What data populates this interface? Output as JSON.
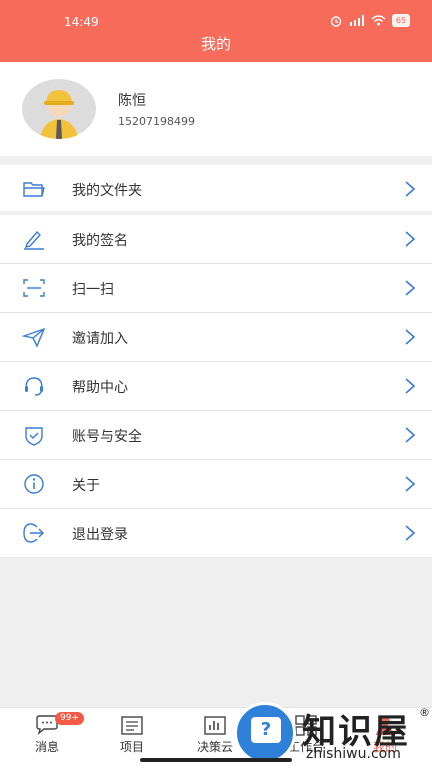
{
  "status_bar": {
    "time": "14:49",
    "battery": "65"
  },
  "header": {
    "title": "我的"
  },
  "profile": {
    "name": "陈恒",
    "phone": "15207198499"
  },
  "menu": [
    {
      "label": "我的文件夹",
      "icon": "folder-icon"
    },
    {
      "label": "我的签名",
      "icon": "pen-icon"
    },
    {
      "label": "扫一扫",
      "icon": "scan-icon"
    },
    {
      "label": "邀请加入",
      "icon": "send-icon"
    },
    {
      "label": "帮助中心",
      "icon": "headset-icon"
    },
    {
      "label": "账号与安全",
      "icon": "shield-icon"
    },
    {
      "label": "关于",
      "icon": "info-icon"
    },
    {
      "label": "退出登录",
      "icon": "logout-icon"
    }
  ],
  "tabbar": {
    "messages": {
      "label": "消息",
      "badge": "99+"
    },
    "projects": {
      "label": "项目"
    },
    "decision": {
      "label": "决策云"
    },
    "workbench": {
      "label": "工作台"
    },
    "mine": {
      "label": "我的"
    }
  },
  "watermark": {
    "text": "知识屋",
    "url": "zhishiwu.com",
    "reg": "®",
    "glyph": "?"
  },
  "colors": {
    "accent": "#f76b5a",
    "icon_blue": "#3a7bd5"
  }
}
